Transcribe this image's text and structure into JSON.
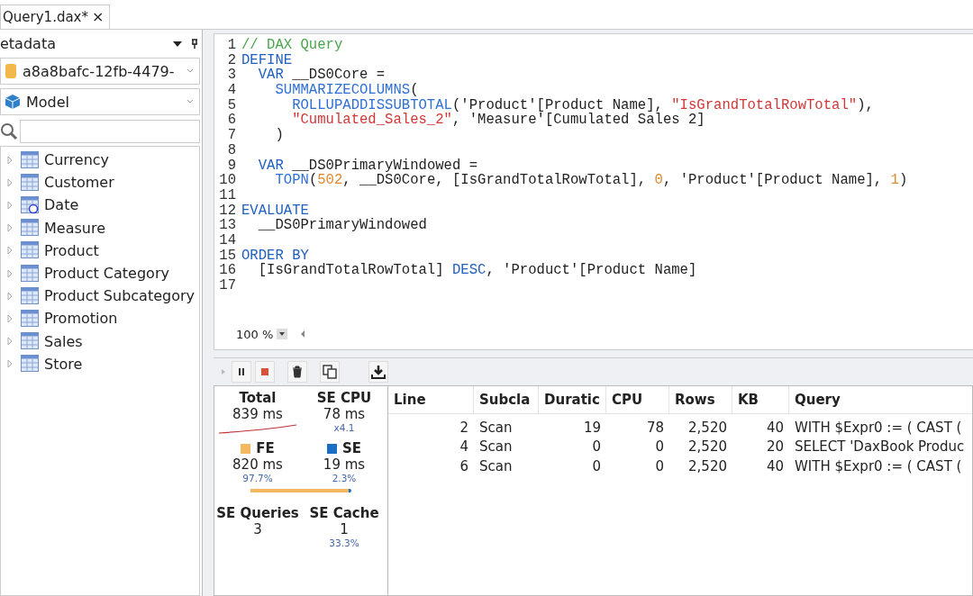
{
  "tabs": [
    {
      "label": "Query1.dax*",
      "close": "×",
      "selected": true
    }
  ],
  "metadata": {
    "title": "etadata",
    "database": "a8a8bafc-12fb-4479-",
    "model": "Model",
    "tables": [
      {
        "name": "Currency",
        "kind": "table",
        "expanded": false
      },
      {
        "name": "Customer",
        "kind": "table",
        "expanded": false
      },
      {
        "name": "Date",
        "kind": "date-table",
        "expanded": false
      },
      {
        "name": "Measure",
        "kind": "table",
        "expanded": false
      },
      {
        "name": "Product",
        "kind": "table",
        "expanded": false
      },
      {
        "name": "Product Category",
        "kind": "table",
        "expanded": false
      },
      {
        "name": "Product Subcategory",
        "kind": "table",
        "expanded": false
      },
      {
        "name": "Promotion",
        "kind": "table",
        "expanded": false
      },
      {
        "name": "Sales",
        "kind": "table",
        "expanded": false
      },
      {
        "name": "Store",
        "kind": "table",
        "expanded": false
      }
    ]
  },
  "editor": {
    "zoom": "100 %",
    "lines": [
      {
        "number": "1",
        "tokens": [
          {
            "text": "// DAX Query",
            "kind": "comment"
          }
        ]
      },
      {
        "number": "2",
        "tokens": [
          {
            "text": "DEFINE",
            "kind": "keyword"
          }
        ]
      },
      {
        "number": "3",
        "tokens": [
          {
            "text": "  VAR",
            "kind": "keyword"
          },
          {
            "text": " __DS0Core =",
            "kind": "plain"
          }
        ]
      },
      {
        "number": "4",
        "tokens": [
          {
            "text": "    SUMMARIZECOLUMNS",
            "kind": "function"
          },
          {
            "text": "(",
            "kind": "plain"
          }
        ]
      },
      {
        "number": "5",
        "tokens": [
          {
            "text": "      ROLLUPADDISSUBTOTAL",
            "kind": "function"
          },
          {
            "text": "('Product'[Product Name], ",
            "kind": "plain"
          },
          {
            "text": "\"IsGrandTotalRowTotal\"",
            "kind": "string"
          },
          {
            "text": "),",
            "kind": "plain"
          }
        ]
      },
      {
        "number": "6",
        "tokens": [
          {
            "text": "      \"Cumulated_Sales_2\"",
            "kind": "string"
          },
          {
            "text": ", 'Measure'[Cumulated Sales 2]",
            "kind": "plain"
          }
        ]
      },
      {
        "number": "7",
        "tokens": [
          {
            "text": "    )",
            "kind": "plain"
          }
        ]
      },
      {
        "number": "8"
      },
      {
        "number": "9",
        "tokens": [
          {
            "text": "  VAR",
            "kind": "keyword"
          },
          {
            "text": " __DS0PrimaryWindowed =",
            "kind": "plain"
          }
        ]
      },
      {
        "number": "10",
        "tokens": [
          {
            "text": "    TOPN",
            "kind": "function"
          },
          {
            "text": "(",
            "kind": "plain"
          },
          {
            "text": "502",
            "kind": "number"
          },
          {
            "text": ", __DS0Core, [IsGrandTotalRowTotal], ",
            "kind": "plain"
          },
          {
            "text": "0",
            "kind": "number"
          },
          {
            "text": ", 'Product'[Product Name], ",
            "kind": "plain"
          },
          {
            "text": "1",
            "kind": "number"
          },
          {
            "text": ")",
            "kind": "plain"
          }
        ]
      },
      {
        "number": "11"
      },
      {
        "number": "12",
        "tokens": [
          {
            "text": "EVALUATE",
            "kind": "keyword"
          }
        ]
      },
      {
        "number": "13",
        "tokens": [
          {
            "text": "  __DS0PrimaryWindowed",
            "kind": "plain"
          }
        ]
      },
      {
        "number": "14"
      },
      {
        "number": "15",
        "tokens": [
          {
            "text": "ORDER BY",
            "kind": "keyword"
          }
        ]
      },
      {
        "number": "16",
        "tokens": [
          {
            "text": "  [IsGrandTotalRowTotal] ",
            "kind": "plain"
          },
          {
            "text": "DESC",
            "kind": "keyword"
          },
          {
            "text": ", 'Product'[Product Name]",
            "kind": "plain"
          }
        ]
      },
      {
        "number": "17"
      }
    ]
  },
  "server_timings": {
    "total": {
      "label": "Total",
      "value": "839 ms"
    },
    "se_cpu": {
      "label": "SE CPU",
      "value": "78 ms",
      "ratio": "x4.1"
    },
    "fe": {
      "label": "FE",
      "value": "820 ms",
      "percent": "97.7%",
      "color": "#f5b860"
    },
    "se": {
      "label": "SE",
      "value": "19 ms",
      "percent": "2.3%",
      "color": "#1a6fc4"
    },
    "split": {
      "level": 0.977
    },
    "se_queries": {
      "label": "SE Queries",
      "value": "3"
    },
    "se_cache": {
      "label": "SE Cache",
      "value": "1",
      "percent": "33.3%"
    },
    "table": {
      "columns": [
        "Line",
        "Subcla",
        "Duratic",
        "CPU",
        "Rows",
        "KB",
        "Query"
      ],
      "rows": [
        [
          "2",
          "Scan",
          "19",
          "78",
          "2,520",
          "40",
          "WITH $Expr0 := ( CAST ("
        ],
        [
          "4",
          "Scan",
          "0",
          "0",
          "2,520",
          "20",
          "SELECT 'DaxBook Produc"
        ],
        [
          "6",
          "Scan",
          "0",
          "0",
          "2,520",
          "40",
          "WITH $Expr0 := ( CAST ("
        ]
      ]
    }
  }
}
